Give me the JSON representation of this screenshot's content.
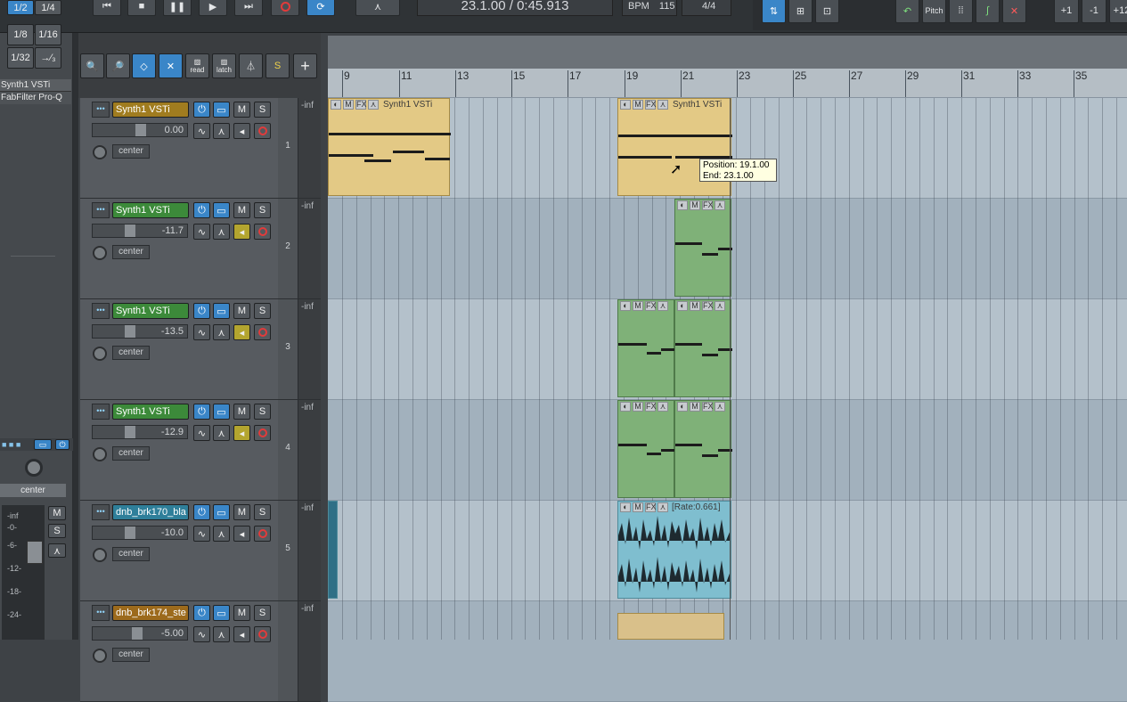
{
  "transport": {
    "position": "23.1.00 / 0:45.913",
    "bpm_label": "BPM",
    "bpm": "115",
    "timesig": "4/4",
    "pitch_label": "Pitch",
    "plus1": "+1",
    "minus1": "-1",
    "plus12": "+12"
  },
  "grid": [
    "1/2",
    "1/4",
    "1/8",
    "1/16",
    "1/32",
    "→⁄₃"
  ],
  "fx_list": [
    "Synth1 VSTi",
    "FabFilter Pro-Q"
  ],
  "toolbar": {
    "read_label": "read",
    "latch_label": "latch"
  },
  "mcp": {
    "pan": "center",
    "meter_labels": [
      "-inf",
      "-0-",
      "-6-",
      "-12-",
      "-18-",
      "-24-"
    ],
    "mute": "M",
    "solo": "S"
  },
  "ruler": [
    "9",
    "11",
    "13",
    "15",
    "17",
    "19",
    "21",
    "23",
    "25",
    "27",
    "29",
    "31",
    "33",
    "35"
  ],
  "tracks": [
    {
      "num": "1",
      "name": "Synth1 VSTi",
      "vol": "0.00",
      "pan": "center",
      "meter": "-inf",
      "color": "#a07c1f"
    },
    {
      "num": "2",
      "name": "Synth1 VSTi",
      "vol": "-11.7",
      "pan": "center",
      "meter": "-inf",
      "color": "#3c8a3a"
    },
    {
      "num": "3",
      "name": "Synth1 VSTi",
      "vol": "-13.5",
      "pan": "center",
      "meter": "-inf",
      "color": "#3c8a3a"
    },
    {
      "num": "4",
      "name": "Synth1 VSTi",
      "vol": "-12.9",
      "pan": "center",
      "meter": "-inf",
      "color": "#3c8a3a"
    },
    {
      "num": "5",
      "name": "dnb_brk170_bla",
      "vol": "-10.0",
      "pan": "center",
      "meter": "-inf",
      "color": "#2f7f9a"
    },
    {
      "num": "",
      "name": "dnb_brk174_ste",
      "vol": "-5.00",
      "pan": "center",
      "meter": "-inf",
      "color": "#9c6a1c"
    }
  ],
  "items": {
    "synth_label": "Synth1 VSTi",
    "rate_label": "[Rate:0.661]"
  },
  "tooltip": {
    "position": "Position: 19.1.00",
    "end": "End: 23.1.00"
  },
  "buttons": {
    "m": "M",
    "s": "S",
    "fx": "FX"
  }
}
